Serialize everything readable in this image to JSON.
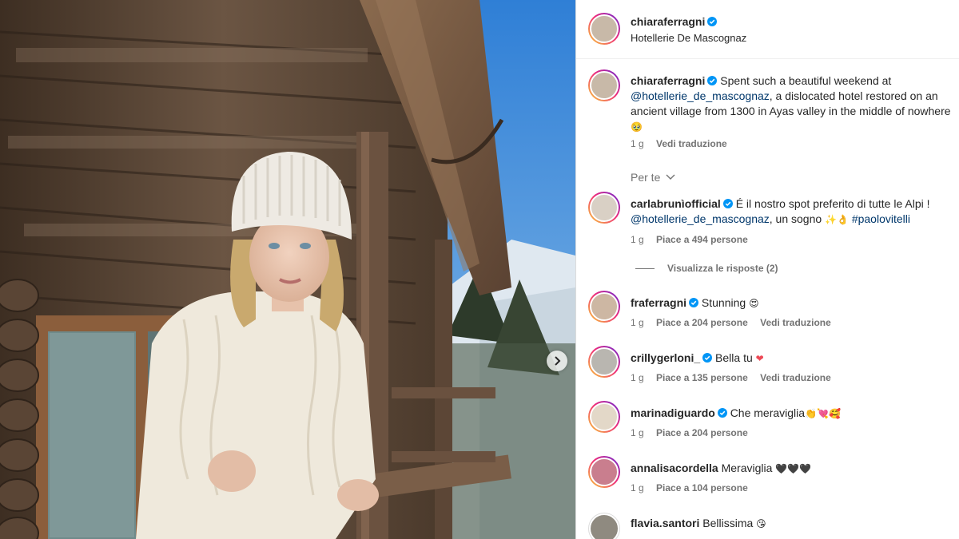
{
  "post": {
    "author": "chiaraferragni",
    "location": "Hotellerie De Mascognaz",
    "caption": {
      "text_1": "Spent such a beautiful weekend at",
      "mention": "@hotellerie_de_mascognaz",
      "text_2": ", a dislocated hotel restored on an ancient village from 1300 in Ayas valley in the middle of nowhere",
      "emoji": "🥹",
      "time": "1 g",
      "translate": "Vedi traduzione"
    },
    "for_you_label": "Per te"
  },
  "comments": [
    {
      "user": "carlabrunìofficial",
      "text_1": "É il nostro spot preferito di tutte le Alpi !",
      "mention": "@hotellerie_de_mascognaz",
      "text_2": ", un sogno",
      "emoji": "✨👌",
      "hashtag": "#paolovitelli",
      "time": "1 g",
      "likes": "Piace a 494 persone",
      "replies": "Visualizza le risposte (2)"
    },
    {
      "user": "fraferragni",
      "text": "Stunning",
      "emoji": "😍",
      "time": "1 g",
      "likes": "Piace a 204 persone",
      "translate": "Vedi traduzione"
    },
    {
      "user": "crillygerloni_",
      "text": "Bella tu",
      "emoji": "❤",
      "time": "1 g",
      "likes": "Piace a 135 persone",
      "translate": "Vedi traduzione"
    },
    {
      "user": "marinadiguardo",
      "text": "Che meraviglia",
      "emoji": "👏💘🥰",
      "time": "1 g",
      "likes": "Piace a 204 persone"
    },
    {
      "user": "annalisacordella",
      "text": "Meraviglia",
      "emoji": "🖤🖤🖤",
      "time": "1 g",
      "likes": "Piace a 104 persone"
    },
    {
      "user": "flavia.santori",
      "text": "Bellissima",
      "emoji": "😘"
    }
  ],
  "icons": {
    "verified": "verified-badge-icon",
    "next": "chevron-right-icon",
    "expand": "chevron-down-icon"
  },
  "colors": {
    "verified": "#0095f6",
    "mention": "#00376b",
    "secondary_text": "#737373"
  }
}
